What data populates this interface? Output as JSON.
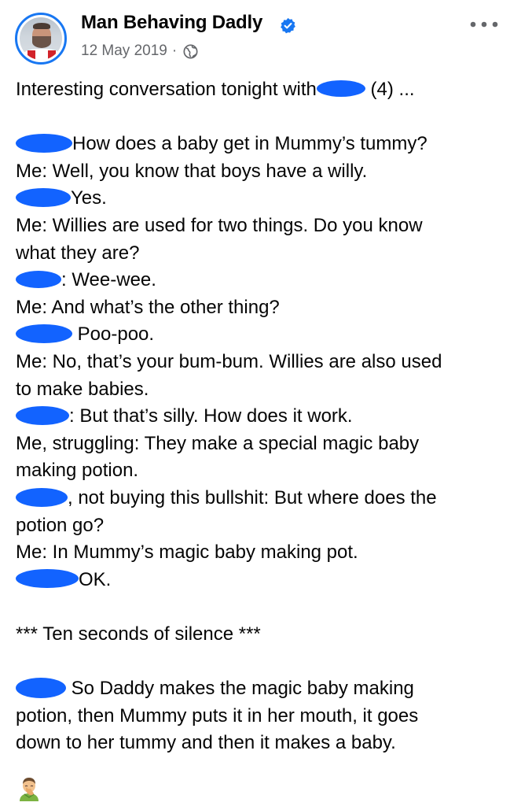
{
  "post": {
    "author": "Man Behaving Dadly",
    "date": "12 May 2019",
    "meta_separator": "·",
    "icons": {
      "verified": "verified-badge-icon",
      "privacy": "globe-icon",
      "more": "more-options-icon",
      "avatar": "profile-photo"
    },
    "colors": {
      "accent": "#1877f2",
      "redaction": "#1263ff",
      "text": "#050505",
      "meta": "#65676b"
    },
    "lines": {
      "l1a": "Interesting conversation tonight with",
      "l1b": " (4) ...",
      "l3": "How does a baby get in Mummy’s tummy?",
      "l4": "Me: Well, you know that boys have a willy.",
      "l5": "Yes.",
      "l6": "Me: Willies are used for two things. Do you know",
      "l7": "what they are?",
      "l8": ": Wee-wee.",
      "l9": "Me: And what’s the other thing?",
      "l10": " Poo-poo.",
      "l11": "Me: No, that’s your bum-bum. Willies are also used",
      "l12": "to make babies.",
      "l13": ": But that’s silly. How does it work.",
      "l14": "Me, struggling: They make a special magic baby",
      "l15": "making potion.",
      "l16": ", not buying this bullshit: But where does the",
      "l17": "potion go?",
      "l18": "Me: In Mummy’s magic baby making pot.",
      "l19": "OK.",
      "l21": "*** Ten seconds of silence ***",
      "l23": " So Daddy makes the magic baby making",
      "l24": "potion, then Mummy puts it in her mouth, it goes",
      "l25": "down to her tummy and then it makes a baby."
    },
    "emoji": "man-facepalming-icon"
  }
}
